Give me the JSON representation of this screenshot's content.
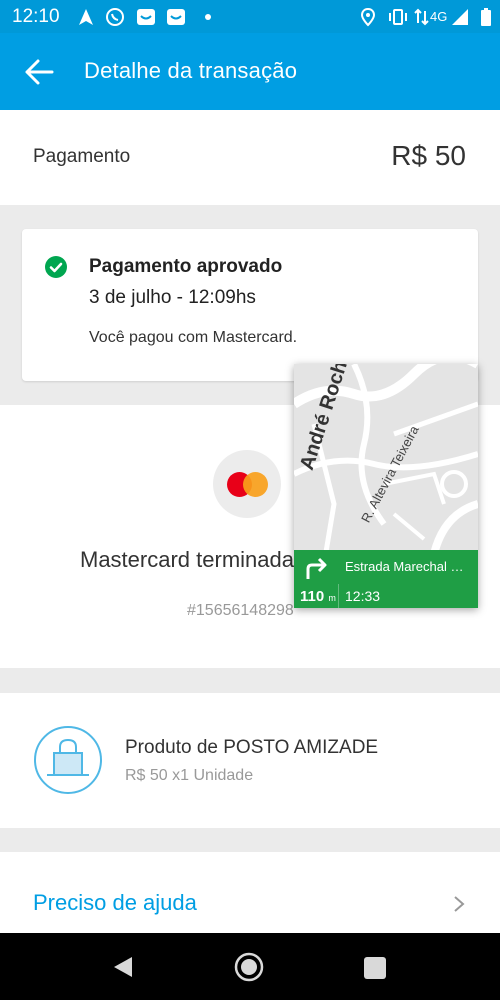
{
  "status_bar": {
    "time": "12:10",
    "network": "4G",
    "icons": [
      "navigation-arrow-icon",
      "whatsapp-icon",
      "mail-icon",
      "mail-icon",
      "dot-icon",
      "location-pin-icon",
      "vibrate-icon",
      "signal-icon",
      "battery-icon"
    ]
  },
  "app_bar": {
    "title": "Detalhe da transação",
    "back_icon": "arrow-left-icon"
  },
  "summary": {
    "label": "Pagamento",
    "amount": "R$ 50"
  },
  "status_card": {
    "title": "Pagamento aprovado",
    "datetime": "3 de julho - 12:09hs",
    "description": "Você pagou com Mastercard.",
    "icon": "check-circle-icon",
    "color": "#00a650"
  },
  "payment_method": {
    "text": "Mastercard terminada",
    "operation_id": "#15656148298",
    "icon": "mastercard-icon"
  },
  "product": {
    "name": "Produto de POSTO AMIZADE",
    "detail": "R$ 50 x1 Unidade",
    "icon": "shopping-bag-icon"
  },
  "help": {
    "label": "Preciso de ajuda",
    "icon": "chevron-right-icon"
  },
  "map_overlay": {
    "road_main": "André Rocha",
    "road_secondary": "R. Altevira Teixeira",
    "next_street": "Estrada Marechal Miguel",
    "distance": "110",
    "distance_unit": "m",
    "eta": "12:33"
  },
  "colors": {
    "primary": "#009ee3",
    "status_bar": "#0099d8",
    "success": "#00a650",
    "nav_green": "#1f9e45"
  }
}
